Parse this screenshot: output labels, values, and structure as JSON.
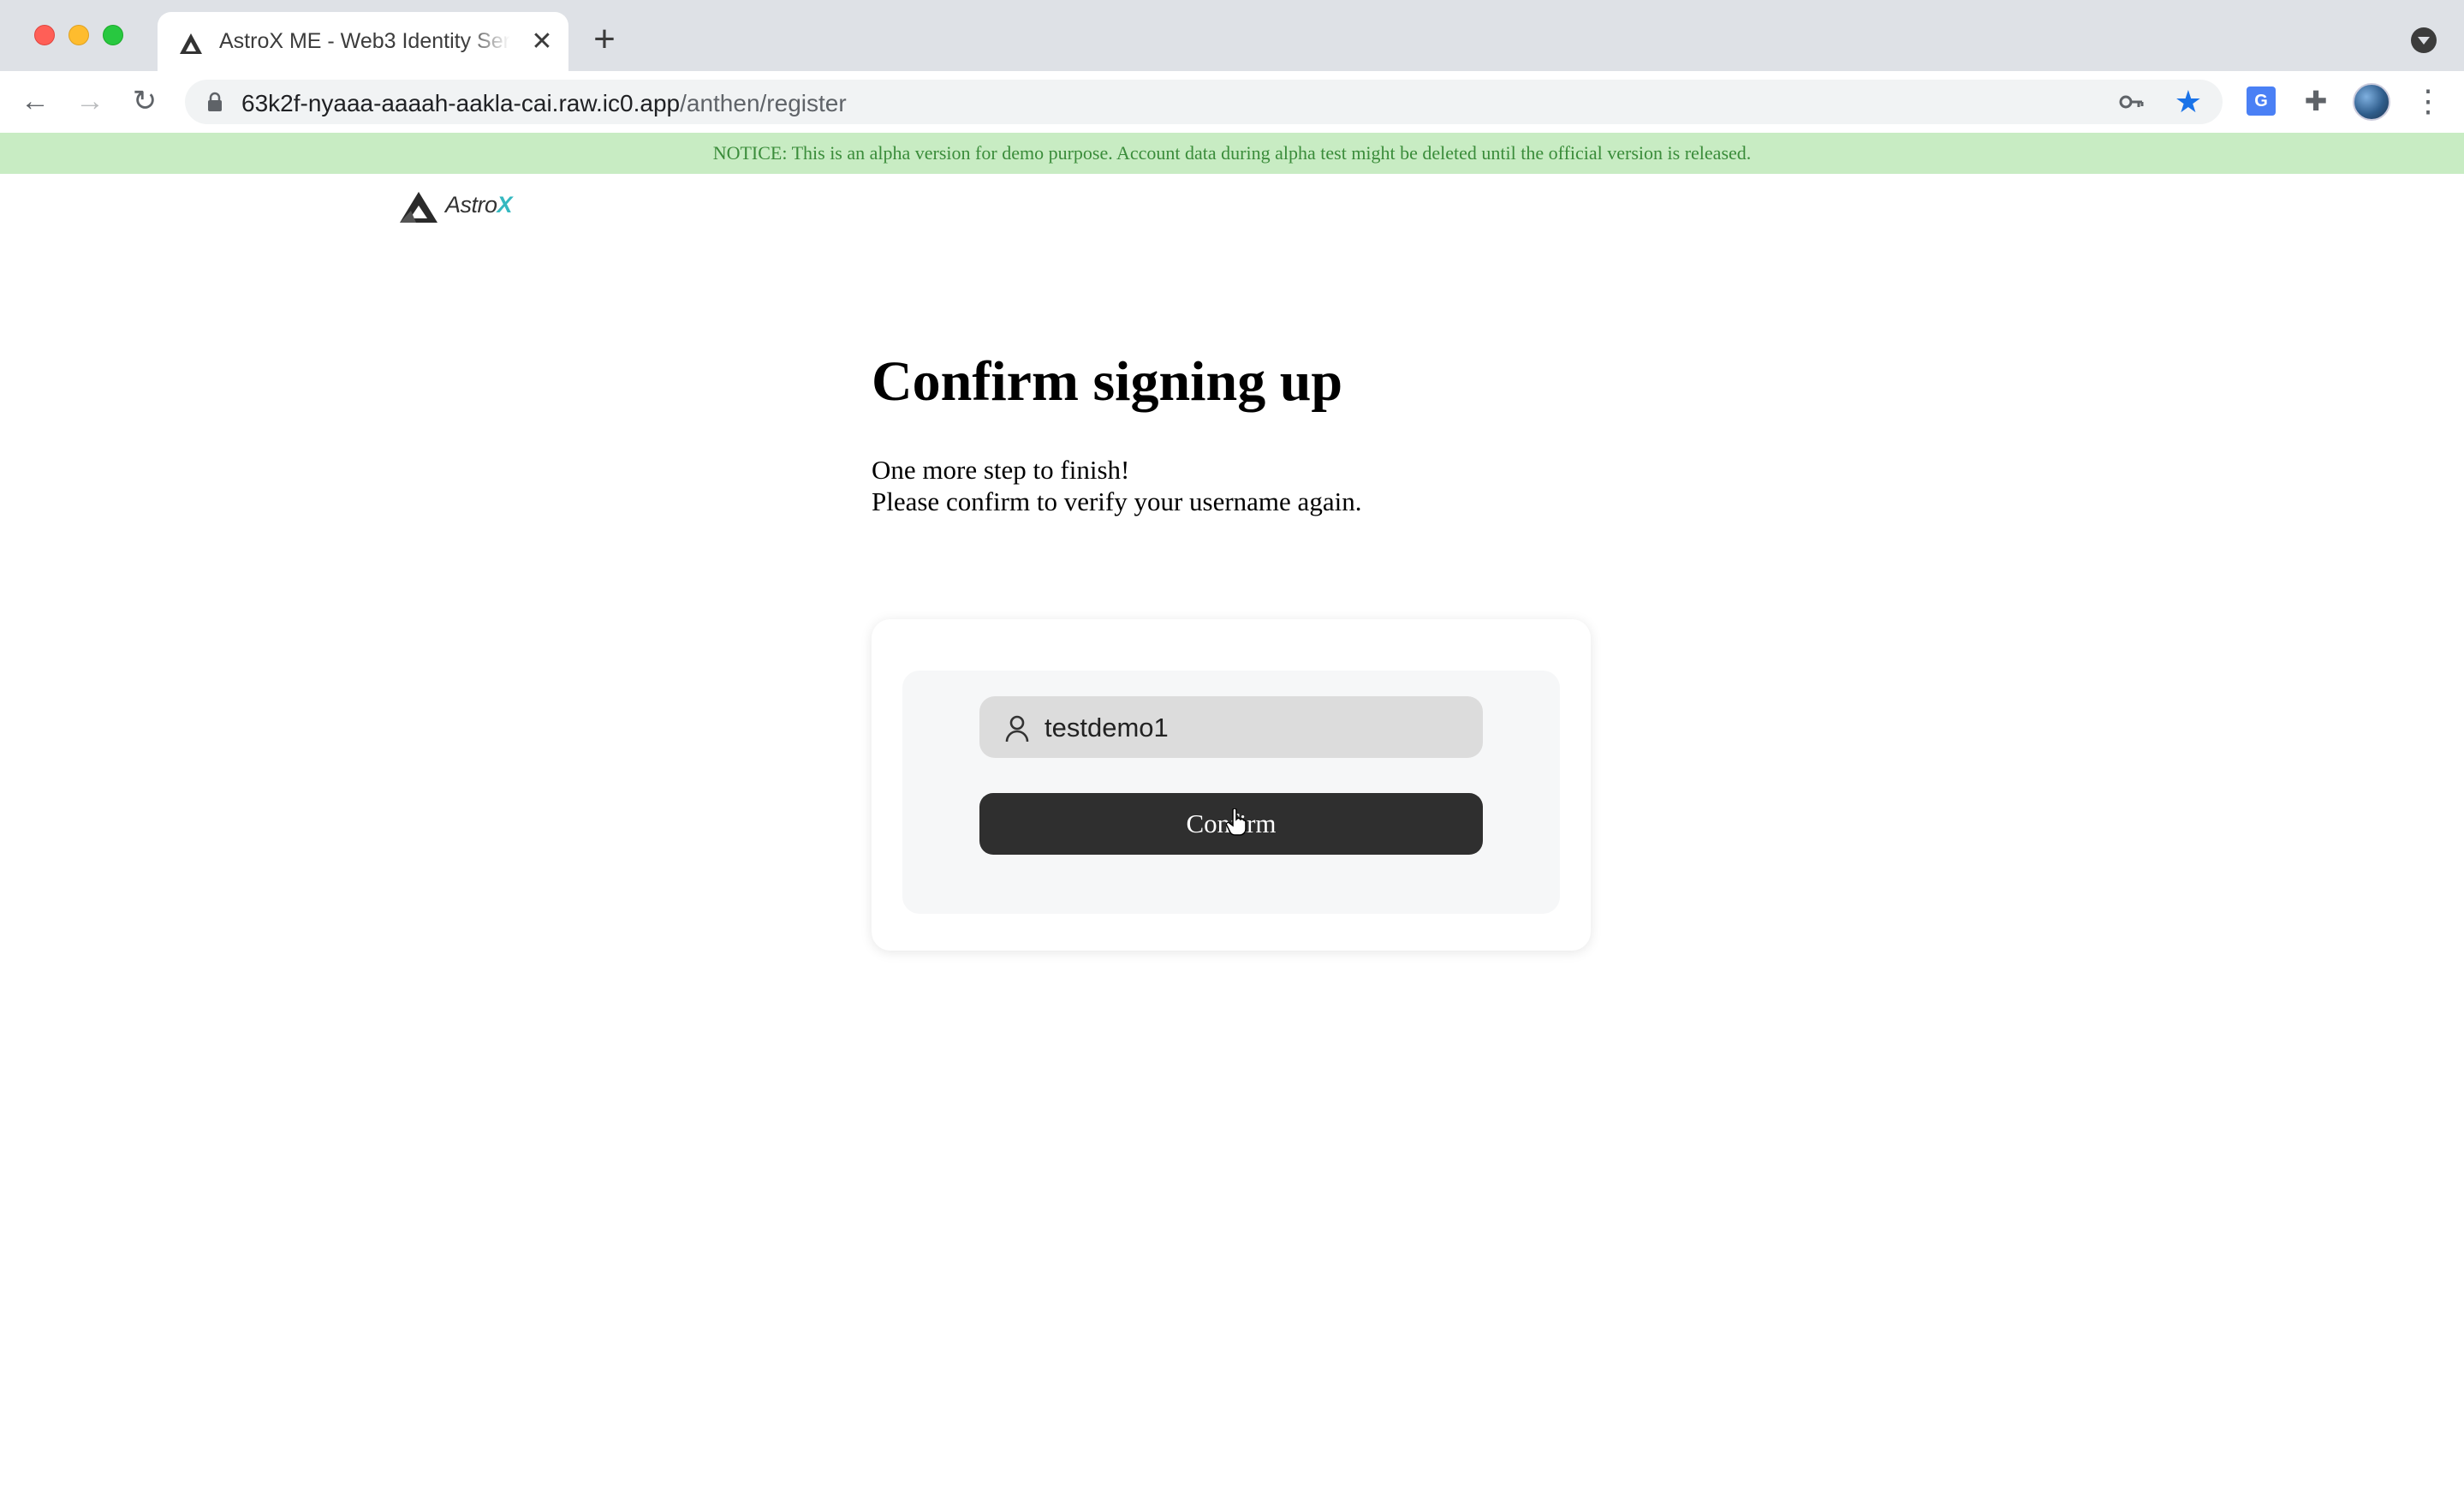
{
  "browser": {
    "tab": {
      "title": "AstroX ME - Web3 Identity Service",
      "close_glyph": "✕"
    },
    "new_tab_glyph": "+",
    "nav": {
      "back": "←",
      "forward": "→",
      "reload": "↻"
    },
    "url": {
      "host": "63k2f-nyaaa-aaaah-aakla-cai.raw.ic0.app",
      "path": "/anthen/register"
    },
    "icons": {
      "key": "key-icon",
      "star": "★",
      "translate": "G",
      "extensions": "✚",
      "menu": "⋮"
    }
  },
  "notice": {
    "text": "NOTICE: This is an alpha version for demo purpose. Account data during alpha test might be deleted until the official version is released."
  },
  "logo": {
    "text": "Astro",
    "accent": "X"
  },
  "page": {
    "title": "Confirm signing up",
    "subtitle_line1": "One more step to finish!",
    "subtitle_line2": "Please confirm to verify your username again."
  },
  "form": {
    "username": "testdemo1",
    "confirm_label": "Confirm"
  },
  "colors": {
    "notice_bg": "#c8ecc3",
    "notice_text": "#3a8c3a",
    "button_bg": "#2f2f2f",
    "brand_accent": "#35b8c0",
    "star": "#1a73e8"
  }
}
